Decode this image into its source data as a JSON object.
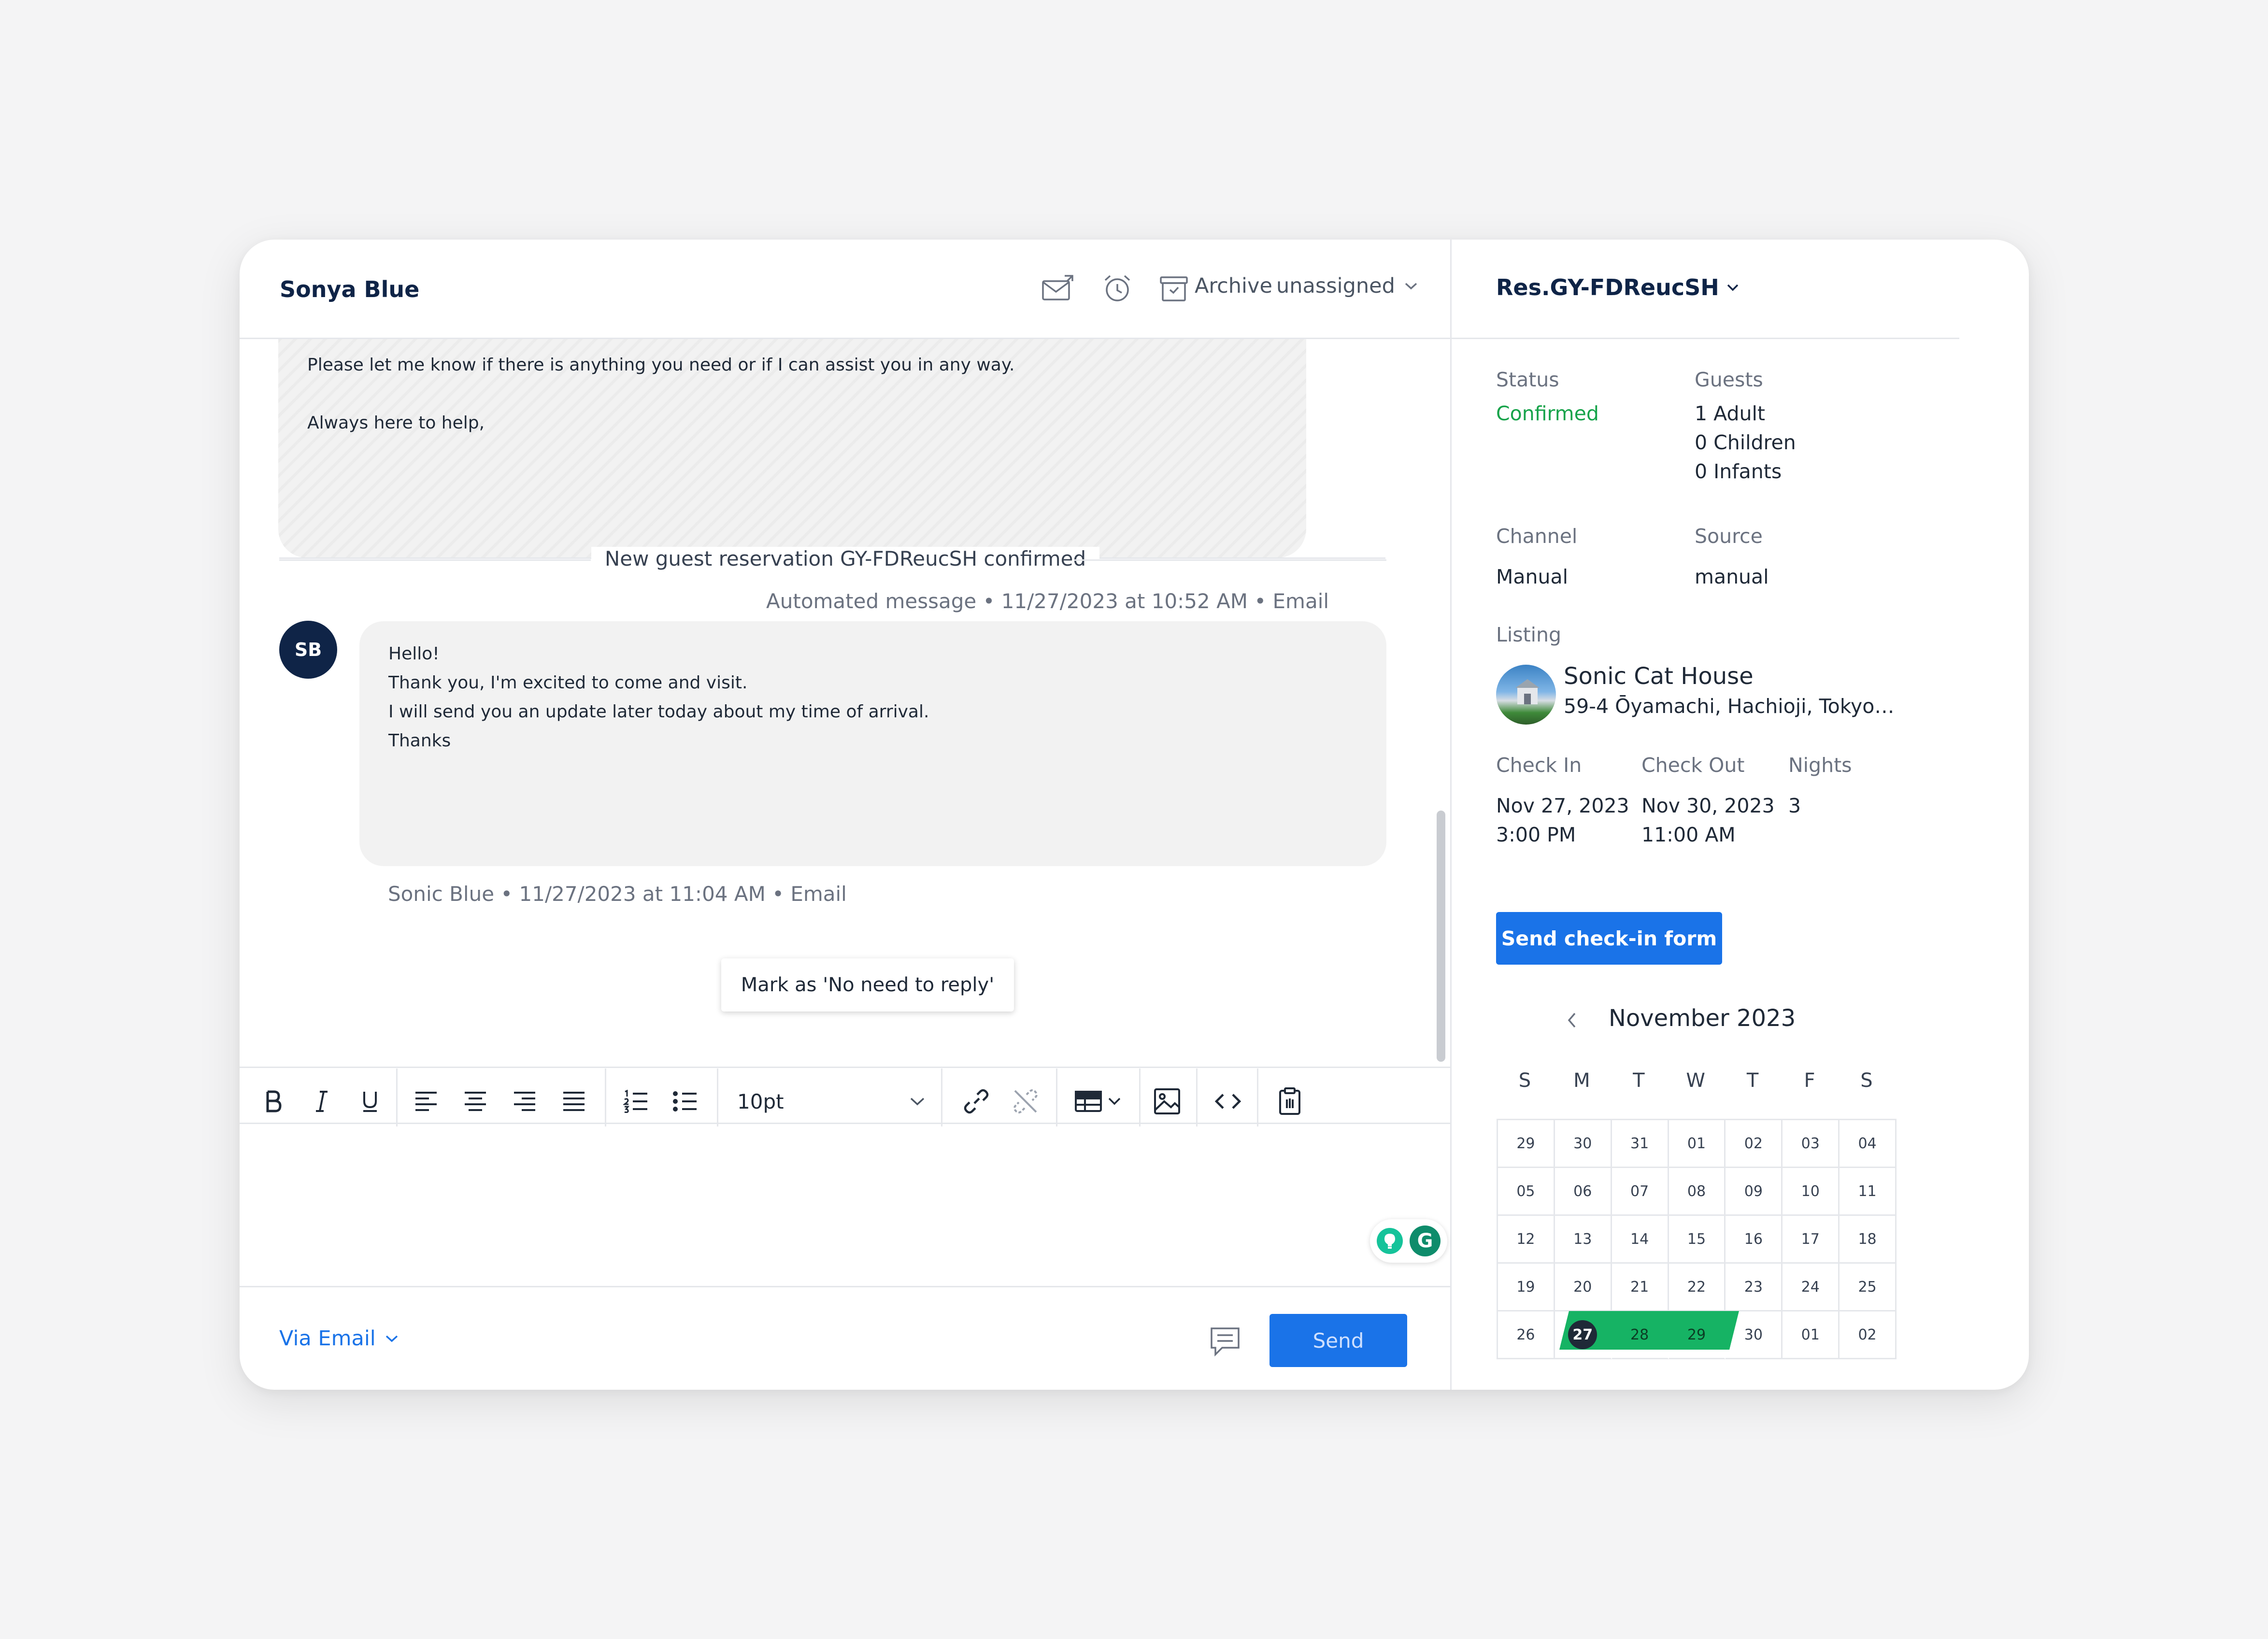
{
  "header": {
    "guest_name": "Sonya Blue",
    "archive_label": "Archive",
    "assignee": "unassigned"
  },
  "conversation": {
    "quoted_lines": [
      "Please let me know if there is anything you need or if I can assist you in any way.",
      "Always here to help,"
    ],
    "automated_meta": "Automated message • 11/27/2023 at 10:52 AM • Email",
    "divider": "New guest reservation GY-FDReucSH confirmed",
    "message": {
      "avatar_initials": "SB",
      "lines": [
        "Hello!",
        "Thank you, I'm excited to come and visit.",
        "I will send you an update later today about my time of arrival.",
        "Thanks"
      ],
      "meta": "Sonic Blue • 11/27/2023 at 11:04 AM • Email"
    },
    "no_reply_button": "Mark as 'No need to reply'"
  },
  "editor": {
    "font_size": "10pt",
    "channel": "Via Email",
    "send_label": "Send"
  },
  "reservation": {
    "title": "Res.GY-FDReucSH",
    "status_label": "Status",
    "status_value": "Confirmed",
    "guests_label": "Guests",
    "guests": [
      "1 Adult",
      "0 Children",
      "0 Infants"
    ],
    "channel_label": "Channel",
    "channel_value": "Manual",
    "source_label": "Source",
    "source_value": "manual",
    "listing_label": "Listing",
    "listing_name": "Sonic Cat House",
    "listing_address": "59-4 Ōyamachi, Hachioji, Tokyo 1...",
    "checkin_label": "Check In",
    "checkin_date": "Nov 27, 2023",
    "checkin_time": "3:00 PM",
    "checkout_label": "Check Out",
    "checkout_date": "Nov 30, 2023",
    "checkout_time": "11:00 AM",
    "nights_label": "Nights",
    "nights_value": "3",
    "checkin_form_button": "Send check-in form"
  },
  "calendar": {
    "month": "November 2023",
    "weekdays": [
      "S",
      "M",
      "T",
      "W",
      "T",
      "F",
      "S"
    ],
    "days": [
      "29",
      "30",
      "31",
      "01",
      "02",
      "03",
      "04",
      "05",
      "06",
      "07",
      "08",
      "09",
      "10",
      "11",
      "12",
      "13",
      "14",
      "15",
      "16",
      "17",
      "18",
      "19",
      "20",
      "21",
      "22",
      "23",
      "24",
      "25",
      "26",
      "27",
      "28",
      "29",
      "30",
      "01",
      "02"
    ],
    "today": "27",
    "stay_days": [
      "27",
      "28",
      "29"
    ]
  },
  "colors": {
    "brand_navy": "#0f2447",
    "primary_blue": "#1a73e8",
    "confirmed_green": "#16a34a",
    "range_green": "#16b364"
  },
  "icons": {
    "header": [
      "mail-icon",
      "alarm-clock-icon",
      "archive-icon",
      "chevron-down-icon"
    ],
    "reservation_header": [
      "pencil-icon",
      "external-link-icon"
    ],
    "sidebar": [
      "collapse-panel-icon",
      "timeline-icon",
      "building-icon",
      "guest-luggage-icon",
      "message-clock-icon",
      "globe-icon"
    ],
    "toolbar": [
      "bold-icon",
      "italic-icon",
      "underline-icon",
      "align-left-icon",
      "align-center-icon",
      "align-right-icon",
      "align-justify-icon",
      "ordered-list-icon",
      "bullet-list-icon",
      "link-icon",
      "unlink-icon",
      "table-icon",
      "image-icon",
      "code-icon",
      "clipboard-icon"
    ]
  }
}
